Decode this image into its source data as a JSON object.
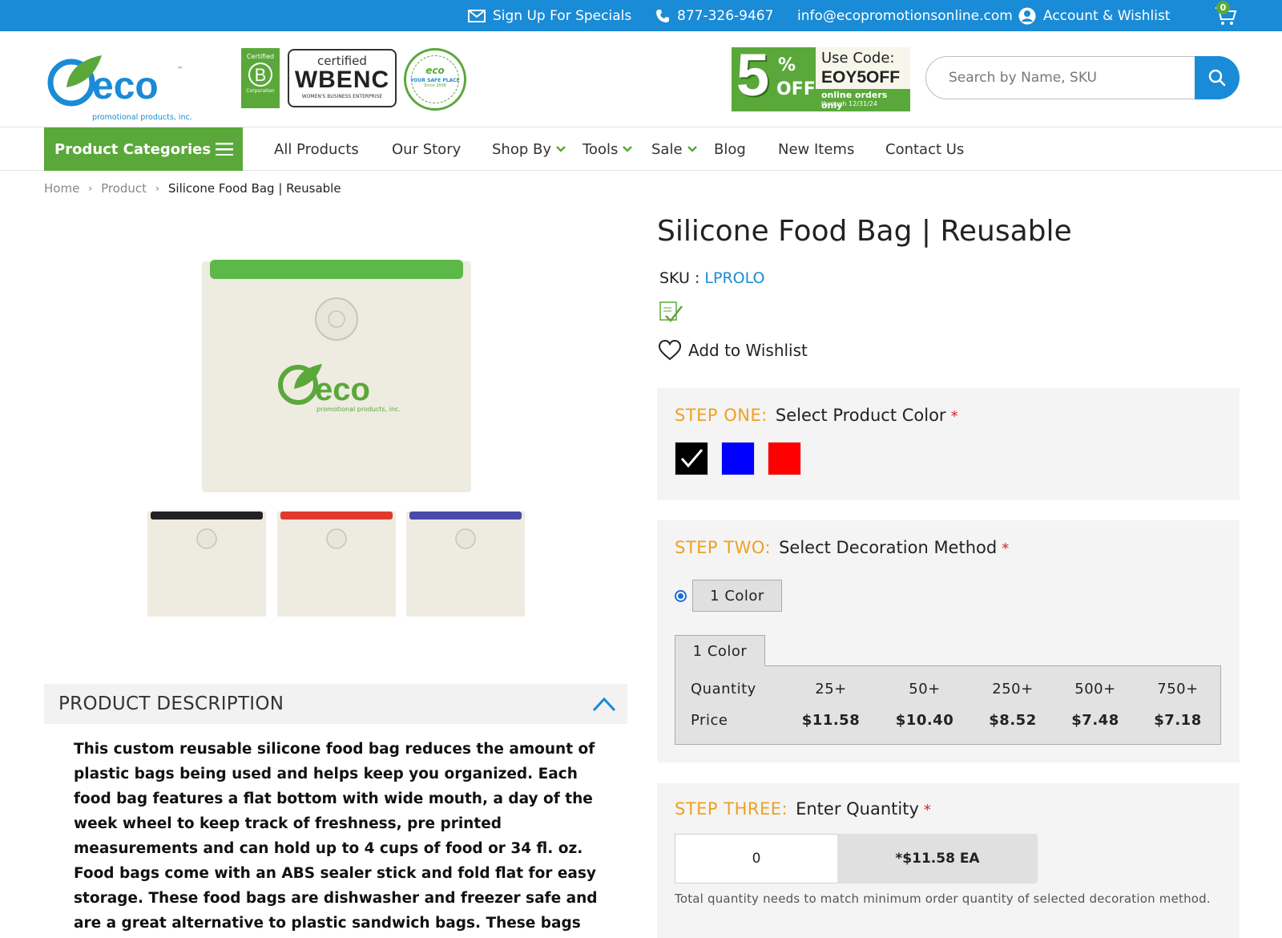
{
  "topbar": {
    "signup": "Sign Up For Specials",
    "phone": "877-326-9467",
    "email": "info@ecopromotionsonline.com",
    "account": "Account & Wishlist",
    "cart_count": "0"
  },
  "header": {
    "logo_word": "eco",
    "logo_tm": "™",
    "logo_sub": "promotional products, inc.",
    "badges": {
      "bcorp_top": "Certified",
      "bcorp_letter": "B",
      "bcorp_bottom": "Corporation",
      "wbenc_top": "certified",
      "wbenc_main": "WBENC",
      "wbenc_sub": "WOMEN'S BUSINESS ENTERPRISE",
      "seal_main": "eco",
      "seal_line": "YOUR SAFE PLACE",
      "seal_since": "Since 2006"
    },
    "promo": {
      "big": "5",
      "pct": "%",
      "off": "OFF",
      "use_code": "Use Code:",
      "code": "EOY5OFF",
      "online": "online orders only",
      "through": "through 12/31/24"
    },
    "search_placeholder": "Search by Name, SKU"
  },
  "nav": {
    "categories": "Product Categories",
    "items": [
      "All Products",
      "Our Story",
      "Shop By",
      "Tools",
      "Sale",
      "Blog",
      "New Items",
      "Contact Us"
    ]
  },
  "breadcrumb": [
    "Home",
    "Product",
    "Silicone Food Bag | Reusable"
  ],
  "gallery": {
    "accent_colors": [
      "#5db84a",
      "#222222",
      "#e03a2f",
      "#4a4aa8"
    ]
  },
  "description": {
    "heading": "PRODUCT DESCRIPTION",
    "text": "This custom reusable silicone food bag reduces the amount of plastic bags being used and helps keep you organized. Each food bag features a flat bottom with wide mouth, a day of the week wheel to keep track of freshness, pre printed measurements and can hold up to 4 cups of food or 34 fl. oz.  Food bags come with an ABS sealer stick and fold flat for easy storage. These food bags are dishwasher and freezer safe and are a great alternative to plastic sandwich bags. These bags are perfect for meal prep,"
  },
  "product": {
    "title": "Silicone Food Bag | Reusable",
    "sku_label": "SKU :",
    "sku": "LPROLO",
    "wishlist": "Add to Wishlist"
  },
  "step1": {
    "key": "STEP ONE:",
    "title": "Select Product Color",
    "required": "*",
    "swatches": [
      "#000000",
      "#0000ff",
      "#ff0000"
    ],
    "selected": 0
  },
  "step2": {
    "key": "STEP TWO:",
    "title": "Select Decoration Method",
    "required": "*",
    "method": "1 Color",
    "tab": "1 Color",
    "row_labels": [
      "Quantity",
      "Price"
    ],
    "quantities": [
      "25+",
      "50+",
      "250+",
      "500+",
      "750+"
    ],
    "prices": [
      "$11.58",
      "$10.40",
      "$8.52",
      "$7.48",
      "$7.18"
    ]
  },
  "step3": {
    "key": "STEP THREE:",
    "title": "Enter Quantity",
    "required": "*",
    "quantity": "0",
    "unit_price": "*$11.58 EA",
    "note": "Total quantity needs to match minimum order quantity of selected decoration method."
  },
  "colors": {
    "brand_blue": "#1a8bd6",
    "brand_green": "#5aa83a",
    "step_orange": "#f0a020",
    "required_red": "#e02020"
  }
}
